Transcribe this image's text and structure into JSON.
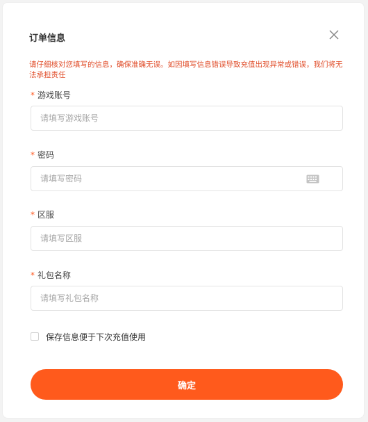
{
  "dialog": {
    "title": "订单信息",
    "warning": "请仔细核对您填写的信息，确保准确无误。如因填写信息错误导致充值出现异常或错误，我们将无法承担责任",
    "required_mark": "*",
    "close_icon": "close-icon",
    "keyboard_icon": "keyboard-icon"
  },
  "fields": {
    "account": {
      "label": "游戏账号",
      "placeholder": "请填写游戏账号",
      "value": ""
    },
    "password": {
      "label": "密码",
      "placeholder": "请填写密码",
      "value": ""
    },
    "server": {
      "label": "区服",
      "placeholder": "请填写区服",
      "value": ""
    },
    "gift": {
      "label": "礼包名称",
      "placeholder": "请填写礼包名称",
      "value": ""
    }
  },
  "save_info": {
    "label": "保存信息便于下次充值使用",
    "checked": false
  },
  "submit": {
    "label": "确定"
  },
  "colors": {
    "accent": "#ff5a1c",
    "warning": "#e04d2a",
    "required": "#ff5a22"
  }
}
